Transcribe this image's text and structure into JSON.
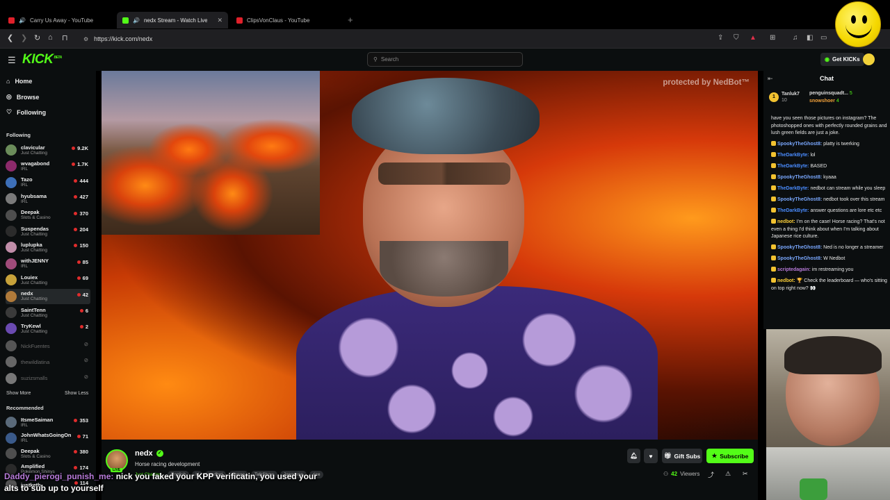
{
  "browser": {
    "tabs": [
      {
        "title": "Carry Us Away - YouTube",
        "favicon": "youtube-icon",
        "active": false
      },
      {
        "title": "nedx Stream - Watch Live on",
        "favicon": "kick-icon",
        "active": true
      },
      {
        "title": "ClipsVonClaus - YouTube",
        "favicon": "youtube-icon",
        "active": false
      }
    ],
    "url": "https://kick.com/nedx"
  },
  "header": {
    "logo": "KICK",
    "logo_badge": "BETA",
    "search_placeholder": "Search",
    "get_kicks": "Get KICKs"
  },
  "sidebar": {
    "nav": [
      {
        "label": "Home",
        "icon": "home-icon"
      },
      {
        "label": "Browse",
        "icon": "compass-icon"
      },
      {
        "label": "Following",
        "icon": "heart-icon"
      }
    ],
    "following_title": "Following",
    "following": [
      {
        "name": "clavicular",
        "category": "Just Chatting",
        "viewers": "9.2K",
        "color": "#6b8c5a"
      },
      {
        "name": "wvagabond",
        "category": "IRL",
        "viewers": "1.7K",
        "color": "#8c2a6a"
      },
      {
        "name": "Tazo",
        "category": "IRL",
        "viewers": "444",
        "color": "#3d6fb8"
      },
      {
        "name": "hyubsama",
        "category": "IRL",
        "viewers": "427",
        "color": "#7a7a7a"
      },
      {
        "name": "Deepak",
        "category": "Slots & Casino",
        "viewers": "370",
        "color": "#4e4e4e"
      },
      {
        "name": "Suspendas",
        "category": "Just Chatting",
        "viewers": "204",
        "color": "#2b2b2b"
      },
      {
        "name": "luplupka",
        "category": "Just Chatting",
        "viewers": "150",
        "color": "#c08da8"
      },
      {
        "name": "withJENNY",
        "category": "IRL",
        "viewers": "85",
        "color": "#a04b7a"
      },
      {
        "name": "Louiex",
        "category": "Just Chatting",
        "viewers": "69",
        "color": "#c7a23a"
      },
      {
        "name": "nedx",
        "category": "Just Chatting",
        "viewers": "42",
        "color": "#b07a3a"
      },
      {
        "name": "SaintTenn",
        "category": "Just Chatting",
        "viewers": "6",
        "color": "#3a3a3a"
      },
      {
        "name": "TryKewl",
        "category": "Just Chatting",
        "viewers": "2",
        "color": "#6a4ab0"
      }
    ],
    "offline": [
      {
        "name": "NickFuentes",
        "color": "#555"
      },
      {
        "name": "thewildlatina",
        "color": "#666"
      },
      {
        "name": "suzizsmalls",
        "color": "#777"
      }
    ],
    "show_more": "Show More",
    "show_less": "Show Less",
    "recommended_title": "Recommended",
    "recommended": [
      {
        "name": "ItsmeSaiman",
        "category": "IRL",
        "viewers": "353",
        "color": "#5a6a7a"
      },
      {
        "name": "JohnWhatsGoingOn",
        "category": "IRL",
        "viewers": "71",
        "color": "#3a5a8a"
      },
      {
        "name": "Deepak",
        "category": "Slots & Casino",
        "viewers": "380",
        "color": "#4e4e4e"
      },
      {
        "name": "Amplified",
        "category": "Pokémon Shinys",
        "viewers": "174",
        "color": "#2a2a2a"
      },
      {
        "name": "justketh",
        "category": "",
        "viewers": "114",
        "color": "#555"
      }
    ]
  },
  "video": {
    "watermark": "protected by NedBot™"
  },
  "stream": {
    "channel": "nedx",
    "title": "Horse racing development",
    "live_label": "LIVE",
    "tags": [
      "Just Chatting",
      "English",
      "irl",
      "nedbot",
      "Japan",
      "TalkShow",
      "Japanese",
      "rice"
    ],
    "viewers": "42",
    "viewers_label": "Viewers",
    "gift_subs": "Gift Subs",
    "subscribe": "Subscribe"
  },
  "caption": {
    "user": "Daddy_pierogi_punish_me:",
    "text": "nick you faked your KPP verificatin, you used your alts to sub up to yourself"
  },
  "chat": {
    "title": "Chat",
    "pinned": [
      {
        "rank": "1",
        "name": "Tanluk7",
        "count": "10"
      },
      {
        "name": "penguinsquadt...",
        "count": "5"
      },
      {
        "name": "snowshoer",
        "count": "4"
      }
    ],
    "messages": [
      {
        "user": "",
        "color": "#ffffff",
        "text": "have you seen those pictures on instagram? The photoshopped ones with perfectly rounded grains and lush green fields are just a joke."
      },
      {
        "user": "SpookyTheGhost8:",
        "color": "#7aa8ff",
        "text": "platty is twerking"
      },
      {
        "user": "TheDarkByte:",
        "color": "#4a8cff",
        "text": "lol"
      },
      {
        "user": "TheDarkByte:",
        "color": "#4a8cff",
        "text": "BASED"
      },
      {
        "user": "SpookyTheGhost8:",
        "color": "#7aa8ff",
        "text": "kyaaa"
      },
      {
        "user": "TheDarkByte:",
        "color": "#4a8cff",
        "text": "nedbot can stream while you sleep"
      },
      {
        "user": "SpookyTheGhost8:",
        "color": "#7aa8ff",
        "text": "nedbot took over this stream"
      },
      {
        "user": "TheDarkByte:",
        "color": "#4a8cff",
        "text": "answer questions are lore etc etc"
      },
      {
        "user": "nedbot:",
        "color": "#ffd23a",
        "text": "I'm on the case! Horse racing? That's not even a thing I'd think about when I'm talking about Japanese rice culture."
      },
      {
        "user": "SpookyTheGhost8:",
        "color": "#7aa8ff",
        "text": "Ned is no longer a streamer"
      },
      {
        "user": "SpookyTheGhost8:",
        "color": "#7aa8ff",
        "text": "W Nedbot"
      },
      {
        "user": "scriptedagain:",
        "color": "#b77ad9",
        "text": "im restreaming you"
      },
      {
        "user": "nedbot:",
        "color": "#ffd23a",
        "text": "🏆 Check the leaderboard — who's sitting on top right now? 👀"
      }
    ]
  }
}
